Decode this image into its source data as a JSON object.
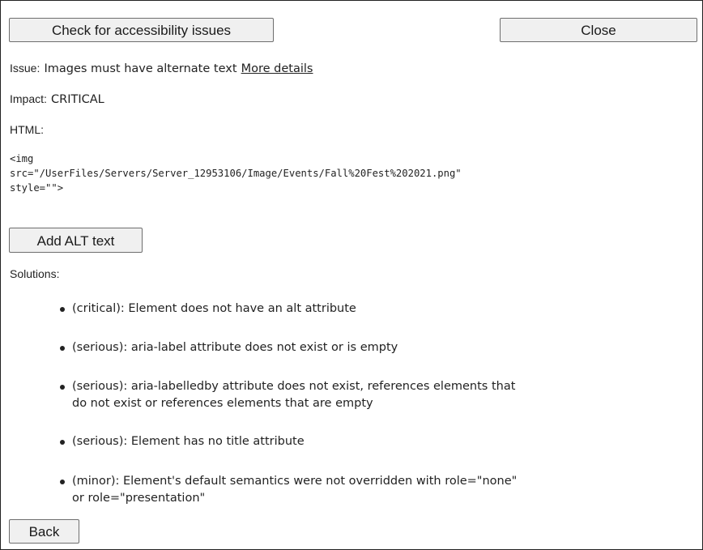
{
  "toolbar": {
    "check_label": "Check for accessibility issues",
    "close_label": "Close"
  },
  "issue": {
    "label": "Issue:",
    "text": "Images must have alternate text",
    "link": "More details"
  },
  "impact": {
    "label": "Impact:",
    "value": "CRITICAL"
  },
  "html_section": {
    "label": "HTML:",
    "code_lines": [
      "<img",
      "src=\"/UserFiles/Servers/Server_12953106/Image/Events/Fall%20Fest%202021.png\"",
      "style=\"\">"
    ]
  },
  "add_alt_label": "Add ALT text",
  "solutions": {
    "label": "Solutions:",
    "items": [
      {
        "lines": [
          "(critical): Element does not have an alt attribute"
        ]
      },
      {
        "lines": [
          "(serious): aria-label attribute does not exist or is empty"
        ]
      },
      {
        "lines": [
          "(serious): aria-labelledby attribute does not exist, references elements that",
          "do not exist or references elements that are empty"
        ]
      },
      {
        "lines": [
          "(serious): Element has no title attribute"
        ]
      },
      {
        "lines": [
          "(minor): Element's default semantics were not overridden with role=\"none\"",
          "or role=\"presentation\""
        ]
      }
    ]
  },
  "back_label": "Back"
}
